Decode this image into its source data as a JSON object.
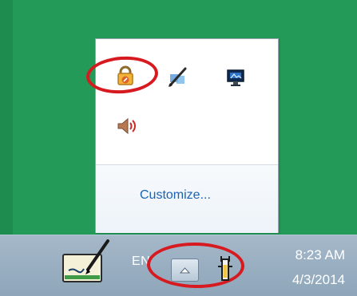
{
  "colors": {
    "desktop": "#239a58",
    "popup_background": "#ffffff",
    "popup_footer": "#edf3f9",
    "link": "#1a63b1",
    "annotation": "#d71920",
    "taskbar": "#9bb0c2",
    "taskbar_text": "#ffffff"
  },
  "popup": {
    "icons": [
      {
        "icon": "lock-icon"
      },
      {
        "icon": "pen-network-icon"
      },
      {
        "icon": "monitor-icon"
      },
      {
        "icon": "speaker-icon"
      }
    ],
    "customize_label": "Customize..."
  },
  "taskbar": {
    "language": "EN",
    "clock": {
      "time": "8:23 AM",
      "date": "4/3/2014"
    },
    "icons": [
      {
        "icon": "pen-tablet-icon"
      },
      {
        "icon": "chevron-up-icon"
      },
      {
        "icon": "power-icon"
      }
    ]
  },
  "annotations": [
    {
      "target": "lock-icon",
      "shape": "oval"
    },
    {
      "target": "chevron-up-icon",
      "shape": "oval"
    }
  ]
}
